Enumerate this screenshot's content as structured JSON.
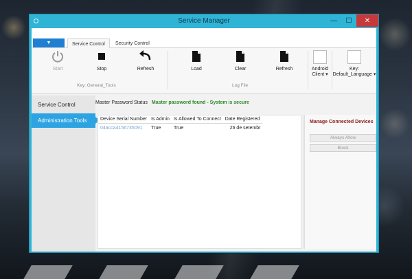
{
  "window": {
    "title": "Service Manager",
    "controls": {
      "minimize": "—",
      "maximize": "☐",
      "close": "✕"
    }
  },
  "tabs": {
    "file_label": "▼",
    "items": [
      {
        "label": "Service Control",
        "active": true
      },
      {
        "label": "Security Control",
        "active": false
      }
    ]
  },
  "ribbon": {
    "general_tools": {
      "buttons": [
        {
          "label": "Start",
          "icon": "power-icon",
          "enabled": false
        },
        {
          "label": "Stop",
          "icon": "stop-icon",
          "enabled": true
        },
        {
          "label": "Refresh",
          "icon": "refresh-icon",
          "enabled": true
        }
      ],
      "group_label": "Key: General_Tools"
    },
    "log_file": {
      "buttons": [
        {
          "label": "Load",
          "icon": "document-icon"
        },
        {
          "label": "Clear",
          "icon": "document-icon"
        },
        {
          "label": "Refresh",
          "icon": "document-icon"
        }
      ],
      "group_label": "Log File"
    },
    "android_client": {
      "label": "Android Client ▾"
    },
    "language": {
      "label_line1": "Key:",
      "label_line2": "Default_Language ▾"
    }
  },
  "sidebar": {
    "items": [
      {
        "label": "Service Control",
        "active": false
      },
      {
        "label": "Administration Tools",
        "active": true
      }
    ]
  },
  "status": {
    "label": "Master Password Status",
    "value": "Master password found - System is secure",
    "value_color": "#2a8a2a"
  },
  "devices_table": {
    "columns": [
      "Device Serial Number",
      "Is Admin",
      "Is Allowed To Connect",
      "Date Registered"
    ],
    "rows": [
      [
        "04acca4156735091",
        "True",
        "True",
        "26 de setembr"
      ]
    ]
  },
  "panel": {
    "title": "Manage Connected Devices",
    "always_allow": "Always Allow",
    "block": "Block"
  },
  "colors": {
    "titlebar": "#2fb4d6",
    "accent": "#2da3e2",
    "close": "#c7383a",
    "panel_title": "#8b1a1a"
  }
}
